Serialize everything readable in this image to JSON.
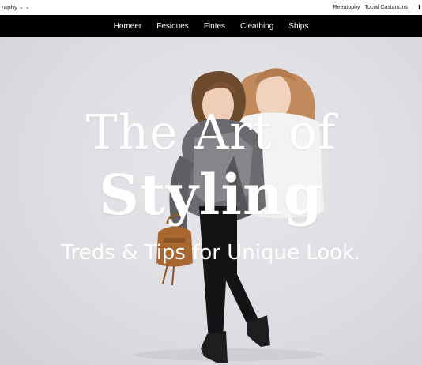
{
  "topbar": {
    "left_label": "raphy",
    "right_links": [
      "Reeatophy",
      "Tocial Castancins"
    ],
    "social_icon": "facebook-icon"
  },
  "nav": {
    "items": [
      "Homeer",
      "Fesiques",
      "Fintes",
      "Cleathing",
      "Ships"
    ]
  },
  "hero": {
    "line1": "The Art of",
    "line2": "Styling",
    "subline": "Treds & Tips for Unique Look."
  },
  "colors": {
    "nav_background": "#000000",
    "hero_background": "#dedee2",
    "headline_text": "#ffffff"
  }
}
